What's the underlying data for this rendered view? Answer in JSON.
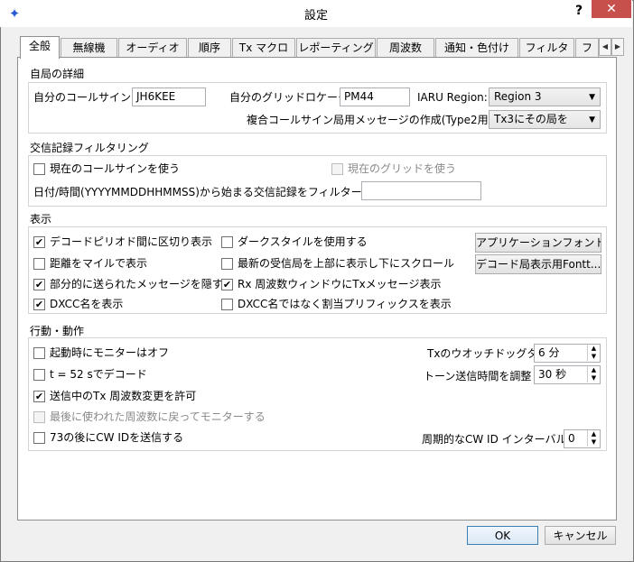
{
  "window": {
    "title": "設定",
    "help_label": "?",
    "close_label": "✕",
    "icon": "wsjt-star-icon"
  },
  "tabs": [
    {
      "label": "全般",
      "active": true
    },
    {
      "label": "無線機"
    },
    {
      "label": "オーディオ"
    },
    {
      "label": "順序"
    },
    {
      "label": "Tx マクロ"
    },
    {
      "label": "レポーティング"
    },
    {
      "label": "周波数"
    },
    {
      "label": "通知・色付け"
    },
    {
      "label": "フィルタ"
    },
    {
      "label": "フ"
    }
  ],
  "tab_scroll": {
    "left": "◀",
    "right": "▶"
  },
  "station": {
    "title": "自局の詳細",
    "callsign_label": "自分のコールサイン:",
    "callsign_value": "JH6KEE",
    "grid_label": "自分のグリッドロケータ:",
    "grid_value": "PM44",
    "iaru_label": "IARU Region:",
    "iaru_value": "Region 3",
    "compound_label": "複合コールサイン局用メッセージの作成(Type2用):",
    "compound_value": "Tx3にその局を"
  },
  "log_filter": {
    "title": "交信記録フィルタリング",
    "use_callsign": "現在のコールサインを使う",
    "use_grid": "現在のグリッドを使う",
    "date_label": "日付/時間(YYYYMMDDHHMMSS)から始まる交信記録をフィルター",
    "date_value": ""
  },
  "display": {
    "title": "表示",
    "decode_separator": "デコードピリオド間に区切り表示",
    "dark_style": "ダークスタイルを使用する",
    "app_font_btn": "アプリケーションフォント…",
    "distance_miles": "距離をマイルで表示",
    "newest_top": "最新の受信局を上部に表示し下にスクロール",
    "decode_font_btn": "デコード局表示用Fontt...",
    "hide_partial": "部分的に送られたメッセージを隠す",
    "rx_tx_msgs": "Rx 周波数ウィンドウにTxメッセージ表示",
    "dxcc_name": "DXCC名を表示",
    "prefix_instead": "DXCC名ではなく割当プリフィックスを表示"
  },
  "behavior": {
    "title": "行動・動作",
    "monitor_off": "起動時にモニターはオフ",
    "decode_52": "t = 52 sでデコード",
    "allow_tx_change": "送信中のTx 周波数変更を許可",
    "return_freq": "最後に使われた周波数に戻ってモニターする",
    "cw_id_73": "73の後にCW IDを送信する",
    "watchdog_label": "Txのウオッチドッグタイマー",
    "watchdog_value": "6 分",
    "tune_label": "トーン送信時間を調整",
    "tune_value": "30 秒",
    "cw_interval_label": "周期的なCW ID インターバル:",
    "cw_interval_value": "0"
  },
  "buttons": {
    "ok": "OK",
    "cancel": "キャンセル"
  },
  "marks": {
    "checked": "✔",
    "spin_up": "▲",
    "spin_down": "▼",
    "combo_arrow": "▼"
  }
}
